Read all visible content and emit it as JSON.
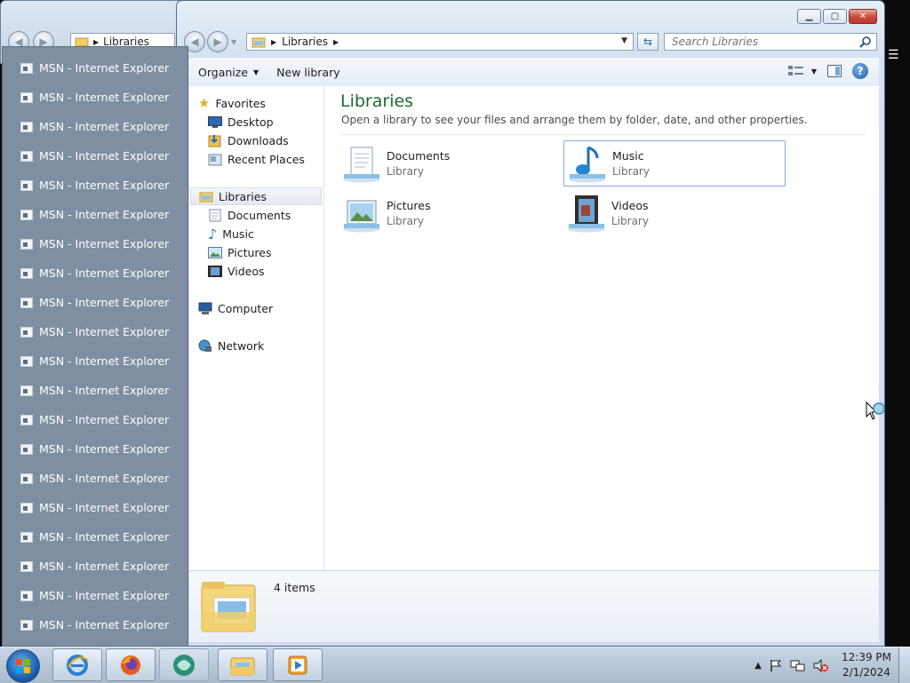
{
  "background_window": {
    "address": "Libraries"
  },
  "window": {
    "controls": {
      "minimize": "▁",
      "maximize": "▢",
      "close": "✕"
    },
    "address_path": "Libraries",
    "search_placeholder": "Search Libraries",
    "toolbar": {
      "organize": "Organize",
      "new_library": "New library",
      "help": "?"
    }
  },
  "nav_pane": {
    "favorites": {
      "label": "Favorites",
      "items": [
        "Desktop",
        "Downloads",
        "Recent Places"
      ]
    },
    "libraries": {
      "label": "Libraries",
      "items": [
        "Documents",
        "Music",
        "Pictures",
        "Videos"
      ]
    },
    "computer": "Computer",
    "network": "Network"
  },
  "content": {
    "title": "Libraries",
    "subtitle": "Open a library to see your files and arrange them by folder, date, and other properties.",
    "libraries": [
      {
        "name": "Documents",
        "type": "Library",
        "icon": "documents-icon"
      },
      {
        "name": "Music",
        "type": "Library",
        "icon": "music-icon",
        "selected": true
      },
      {
        "name": "Pictures",
        "type": "Library",
        "icon": "pictures-icon"
      },
      {
        "name": "Videos",
        "type": "Library",
        "icon": "videos-icon"
      }
    ]
  },
  "details": {
    "count": "4 items"
  },
  "popup": {
    "items": [
      "MSN - Internet Explorer",
      "MSN - Internet Explorer",
      "MSN - Internet Explorer",
      "MSN - Internet Explorer",
      "MSN - Internet Explorer",
      "MSN - Internet Explorer",
      "MSN - Internet Explorer",
      "MSN - Internet Explorer",
      "MSN - Internet Explorer",
      "MSN - Internet Explorer",
      "MSN - Internet Explorer",
      "MSN - Internet Explorer",
      "MSN - Internet Explorer",
      "MSN - Internet Explorer",
      "MSN - Internet Explorer",
      "MSN - Internet Explorer",
      "MSN - Internet Explorer",
      "MSN - Internet Explorer",
      "MSN - Internet Explorer",
      "MSN - Internet Explorer"
    ]
  },
  "taskbar": {
    "apps": [
      "internet-explorer-icon",
      "firefox-icon",
      "app-icon",
      "file-explorer-icon",
      "media-player-icon"
    ],
    "clock": {
      "time": "12:39 PM",
      "date": "2/1/2024"
    }
  },
  "colors": {
    "title_green": "#1e6b2d",
    "popup_bg": "#7e8fa2",
    "selection_border": "#84acdd"
  }
}
